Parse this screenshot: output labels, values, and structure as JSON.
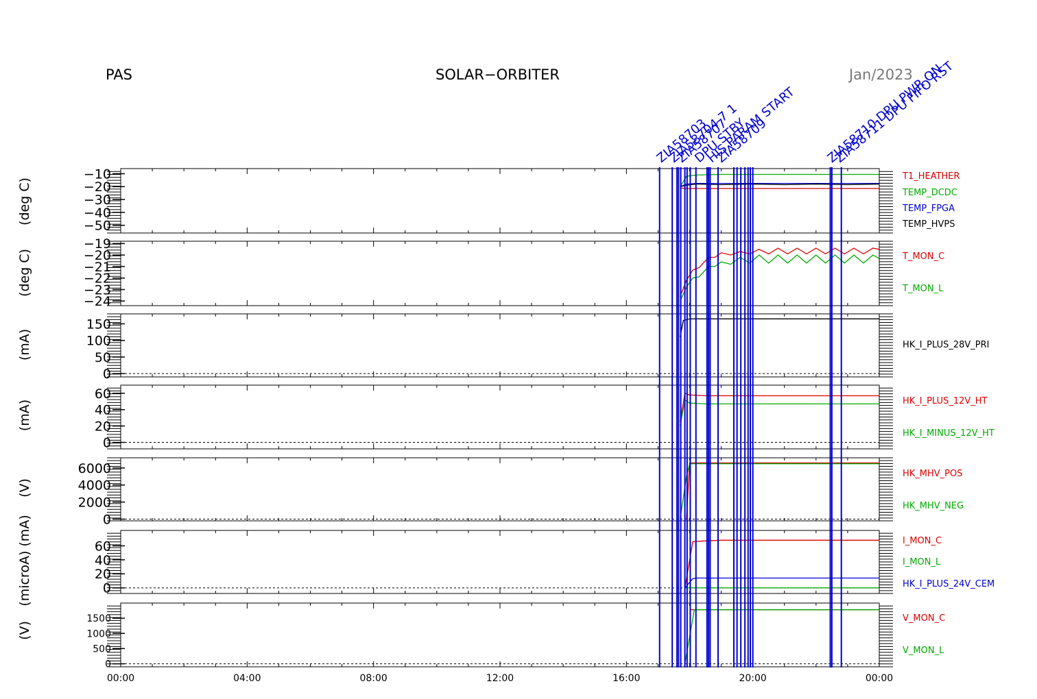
{
  "header": {
    "instrument": "PAS",
    "mission": "SOLAR−ORBITER",
    "date": "Jan/2023"
  },
  "colors": {
    "red": "#dd0000",
    "green": "#00aa00",
    "blue": "#0000cc",
    "black": "#000000"
  },
  "chart_data": {
    "type": "line",
    "x_tick_labels": [
      "00:00",
      "04:00",
      "08:00",
      "12:00",
      "16:00",
      "20:00",
      "00:00"
    ],
    "x_range_hours": [
      0,
      24
    ],
    "event_markers": {
      "color": "#0000cc",
      "times_hours": [
        17.05,
        17.45,
        17.6,
        17.65,
        17.72,
        17.85,
        17.92,
        18.02,
        18.2,
        18.55,
        18.6,
        18.65,
        18.9,
        19.4,
        19.5,
        19.62,
        19.75,
        19.85,
        19.92,
        20.0,
        22.45,
        22.5,
        22.8
      ],
      "labels": [
        {
          "t": 17.1,
          "text": "ZIA58703"
        },
        {
          "t": 17.5,
          "text": "ZIA58704 7 1"
        },
        {
          "t": 17.75,
          "text": "ZIA58707"
        },
        {
          "t": 18.3,
          "text": "DPU STBY"
        },
        {
          "t": 18.7,
          "text": "HIS PARAM START"
        },
        {
          "t": 19.0,
          "text": "ZIA58709"
        },
        {
          "t": 22.5,
          "text": "ZIA58710 DPU PWR ON"
        },
        {
          "t": 22.75,
          "text": "ZIA58711 DPU FIFO RST"
        }
      ]
    },
    "panels": [
      {
        "ylabel": "(deg C)",
        "yticks": [
          -10,
          -20,
          -30,
          -40,
          -50
        ],
        "ylim": [
          -56,
          -6
        ],
        "zero_line": false,
        "series": [
          {
            "name": "T1_HEATHER",
            "color": "#dd0000",
            "x": [
              17.7,
              17.9,
              18.2,
              19,
              20,
              21,
              22,
              23,
              24
            ],
            "y": [
              -21,
              -21.5,
              -21.5,
              -21.5,
              -21.5,
              -21.5,
              -21.5,
              -21.5,
              -21.5
            ]
          },
          {
            "name": "TEMP_DCDC",
            "color": "#00aa00",
            "x": [
              17.7,
              17.9,
              18.2,
              19,
              20,
              21,
              22,
              23,
              24
            ],
            "y": [
              -20,
              -12,
              -11,
              -10.5,
              -10.5,
              -10.5,
              -10.5,
              -10.5,
              -10.5
            ]
          },
          {
            "name": "TEMP_FPGA",
            "color": "#0000cc",
            "x": [
              17.7,
              17.9,
              18.2,
              19,
              20,
              21,
              22,
              23,
              24
            ],
            "y": [
              -20,
              -18,
              -17.5,
              -17.5,
              -17.5,
              -17.5,
              -17.5,
              -17.5,
              -17.5
            ]
          },
          {
            "name": "TEMP_HVPS",
            "color": "#000000",
            "x": [
              17.7,
              17.9,
              18.2,
              19,
              20,
              21,
              22,
              23,
              24
            ],
            "y": [
              -20,
              -19,
              -18,
              -18.5,
              -18,
              -18.5,
              -18,
              -18.5,
              -18
            ]
          }
        ]
      },
      {
        "ylabel": "(deg C)",
        "yticks": [
          -19,
          -20,
          -21,
          -22,
          -23,
          -24
        ],
        "ylim": [
          -24.4,
          -18.8
        ],
        "zero_line": false,
        "series": [
          {
            "name": "T_MON_C",
            "color": "#dd0000",
            "x": [
              17.7,
              17.9,
              18.1,
              18.3,
              18.6,
              18.8,
              19.0,
              19.3,
              19.6,
              19.9,
              20.2,
              20.5,
              20.8,
              21.1,
              21.4,
              21.7,
              22.0,
              22.3,
              22.6,
              22.9,
              23.2,
              23.5,
              23.8,
              24.0
            ],
            "y": [
              -23.6,
              -22.2,
              -21.3,
              -21.1,
              -20.2,
              -20.2,
              -19.8,
              -20.0,
              -19.7,
              -19.9,
              -19.5,
              -19.9,
              -19.4,
              -19.9,
              -19.4,
              -19.9,
              -19.4,
              -19.9,
              -19.4,
              -19.9,
              -19.4,
              -19.9,
              -19.4,
              -19.5
            ]
          },
          {
            "name": "T_MON_L",
            "color": "#00aa00",
            "x": [
              17.7,
              17.9,
              18.1,
              18.3,
              18.6,
              18.8,
              19.0,
              19.3,
              19.6,
              19.9,
              20.2,
              20.5,
              20.8,
              21.1,
              21.4,
              21.7,
              22.0,
              22.3,
              22.6,
              22.9,
              23.2,
              23.5,
              23.8,
              24.0
            ],
            "y": [
              -24.0,
              -22.8,
              -22.0,
              -21.9,
              -21.0,
              -21.0,
              -20.6,
              -20.8,
              -20.2,
              -20.7,
              -20.0,
              -20.7,
              -20.0,
              -20.7,
              -20.0,
              -20.7,
              -20.0,
              -20.7,
              -20.0,
              -20.7,
              -20.0,
              -20.7,
              -20.0,
              -20.3
            ]
          }
        ]
      },
      {
        "ylabel": "(mA)",
        "yticks": [
          150,
          100,
          50,
          0
        ],
        "ylim": [
          -10,
          180
        ],
        "zero_line": true,
        "series": [
          {
            "name": "HK_I_PLUS_28V_PRI",
            "color": "#000000",
            "x": [
              17.7,
              17.8,
              18.0,
              18.5,
              20,
              22,
              24
            ],
            "y": [
              110,
              160,
              165,
              165,
              165,
              165,
              165
            ]
          }
        ]
      },
      {
        "ylabel": "(mA)",
        "yticks": [
          60,
          40,
          20,
          0
        ],
        "ylim": [
          -8,
          70
        ],
        "zero_line": true,
        "series": [
          {
            "name": "HK_I_PLUS_12V_HT",
            "color": "#dd0000",
            "x": [
              17.7,
              17.85,
              18.0,
              18.5,
              20,
              22,
              24
            ],
            "y": [
              25,
              60,
              58,
              57,
              57,
              57,
              57
            ]
          },
          {
            "name": "HK_I_MINUS_12V_HT",
            "color": "#00aa00",
            "x": [
              17.7,
              17.85,
              18.0,
              18.5,
              20,
              22,
              24
            ],
            "y": [
              20,
              52,
              48,
              47,
              47,
              47,
              47
            ]
          }
        ]
      },
      {
        "ylabel": "(V)",
        "yticks": [
          6000,
          4000,
          2000,
          0
        ],
        "ylim": [
          -200,
          7200
        ],
        "zero_line": true,
        "series": [
          {
            "name": "HK_MHV_POS",
            "color": "#dd0000",
            "x": [
              17.9,
              18.0,
              18.1,
              24
            ],
            "y": [
              0,
              6600,
              6600,
              6600
            ]
          },
          {
            "name": "HK_MHV_NEG",
            "color": "#00aa00",
            "x": [
              17.7,
              17.9,
              18.0,
              24
            ],
            "y": [
              0,
              5000,
              6500,
              6500
            ]
          }
        ]
      },
      {
        "ylabel": "(microA) (mA)",
        "yticks": [
          60,
          40,
          20,
          0
        ],
        "ylim": [
          -8,
          82
        ],
        "zero_line": true,
        "series": [
          {
            "name": "I_MON_C",
            "color": "#dd0000",
            "x": [
              17.85,
              18.1,
              18.5,
              19.0,
              24
            ],
            "y": [
              0,
              66,
              67,
              68,
              68
            ]
          },
          {
            "name": "I_MON_L",
            "color": "#00aa00",
            "x": [
              17.85,
              18.1,
              24
            ],
            "y": [
              0,
              0,
              0
            ]
          },
          {
            "name": "HK_I_PLUS_24V_CEM",
            "color": "#0000cc",
            "x": [
              17.85,
              18.1,
              18.2,
              24
            ],
            "y": [
              0,
              13,
              14,
              14
            ]
          }
        ]
      },
      {
        "ylabel": "(V)",
        "yticks": [
          1500,
          1000,
          500,
          0
        ],
        "ylim": [
          -100,
          2000
        ],
        "zero_line": true,
        "series": [
          {
            "name": "V_MON_C",
            "color": "#dd0000",
            "x": [
              18.0,
              24
            ],
            "y": [
              1780,
              1780
            ]
          },
          {
            "name": "V_MON_L",
            "color": "#00aa00",
            "x": [
              17.85,
              18.15,
              18.3,
              24
            ],
            "y": [
              0,
              1780,
              1780,
              1780
            ]
          }
        ]
      }
    ]
  }
}
